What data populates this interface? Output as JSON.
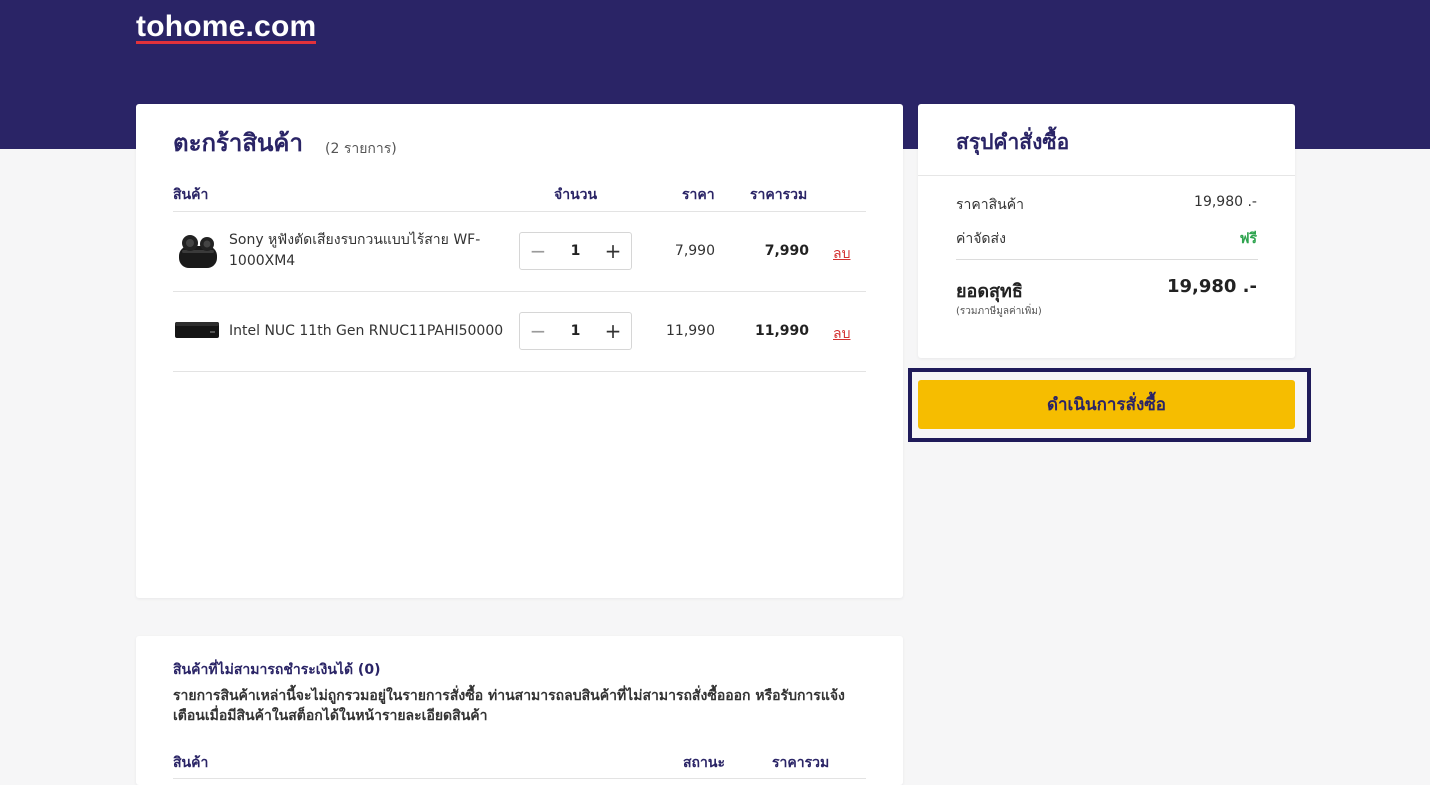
{
  "brand": {
    "logo": "tohome.com"
  },
  "cart": {
    "title": "ตะกร้าสินค้า",
    "count": "(2 รายการ)",
    "columns": {
      "product": "สินค้า",
      "qty": "จำนวน",
      "price": "ราคา",
      "total": "ราคารวม"
    },
    "items": [
      {
        "name": "Sony หูฟังตัดเสียงรบกวนแบบไร้สาย WF-1000XM4",
        "qty": "1",
        "price": "7,990",
        "total": "7,990",
        "delete_label": "ลบ",
        "minus": "−",
        "plus": "+"
      },
      {
        "name": "Intel NUC 11th Gen RNUC11PAHI50000",
        "qty": "1",
        "price": "11,990",
        "total": "11,990",
        "delete_label": "ลบ",
        "minus": "−",
        "plus": "+"
      }
    ]
  },
  "summary": {
    "title": "สรุปคำสั่งซื้อ",
    "subtotal_label": "ราคาสินค้า",
    "subtotal_value": "19,980 .-",
    "shipping_label": "ค่าจัดส่ง",
    "shipping_value": "ฟรี",
    "net_label": "ยอดสุทธิ",
    "net_value": "19,980 .-",
    "vat_note": "(รวมภาษีมูลค่าเพิ่ม)",
    "checkout_label": "ดำเนินการสั่งซื้อ"
  },
  "unavailable": {
    "title": "สินค้าที่ไม่สามารถชำระเงินได้ (0)",
    "description": "รายการสินค้าเหล่านี้จะไม่ถูกรวมอยู่ในรายการสั่งซื้อ ท่านสามารถลบสินค้าที่ไม่สามารถสั่งซื้อออก หรือรับการแจ้งเตือนเมื่อมีสินค้าในสต็อกได้ในหน้ารายละเอียดสินค้า",
    "columns": {
      "product": "สินค้า",
      "status": "สถานะ",
      "total": "ราคารวม"
    }
  },
  "colors": {
    "brand_navy": "#2a2466",
    "checkout_yellow": "#f6bd00",
    "delete_red": "#d32f2f",
    "free_green": "#2ea44f",
    "logo_underline": "#e2323b"
  }
}
